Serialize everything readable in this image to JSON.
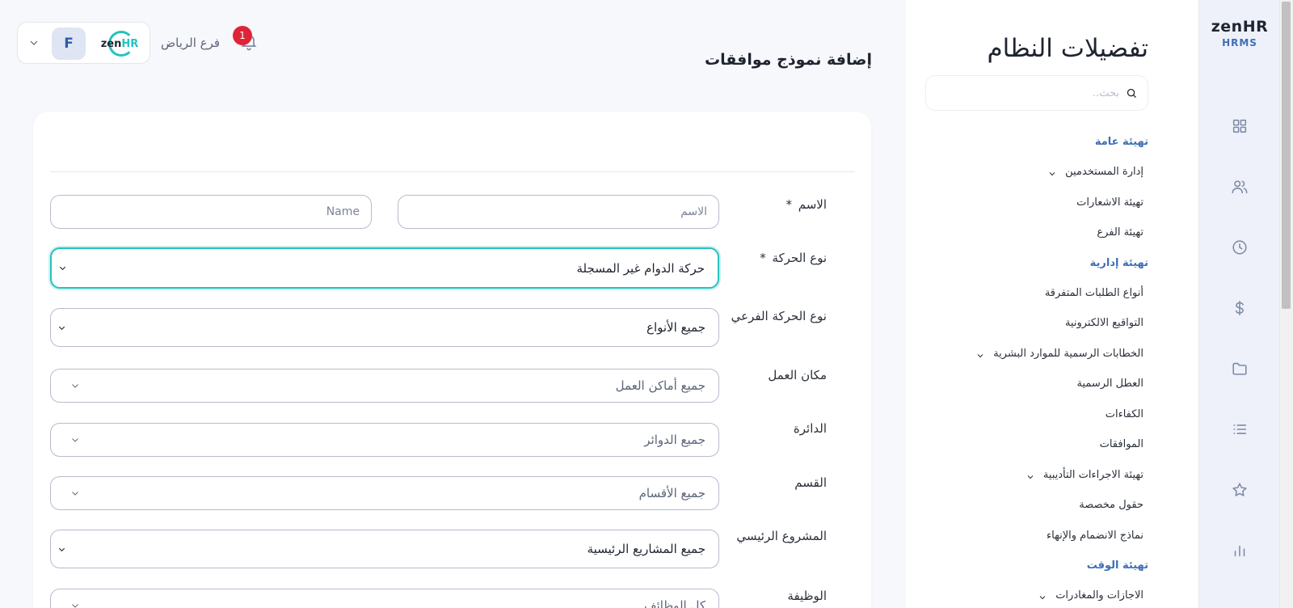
{
  "brand": {
    "word_main": "zen",
    "word_accent": "HR",
    "sub": "HRMS"
  },
  "rail_icons": [
    "dashboard-icon",
    "users-icon",
    "clock-icon",
    "dollar-icon",
    "folder-icon",
    "list-icon",
    "star-icon",
    "chart-icon"
  ],
  "settings": {
    "title": "تفضيلات النظام",
    "search_placeholder": "بحث..",
    "menu": [
      {
        "type": "group",
        "label": "تهيئة عامة"
      },
      {
        "type": "item",
        "label": "إدارة المستخدمين",
        "expandable": true
      },
      {
        "type": "item",
        "label": "تهيئة الاشعارات"
      },
      {
        "type": "item",
        "label": "تهيئة الفرع"
      },
      {
        "type": "group",
        "label": "تهيئة إدارية"
      },
      {
        "type": "item",
        "label": "أنواع الطلبات المتفرقة"
      },
      {
        "type": "item",
        "label": "التواقيع الالكترونية"
      },
      {
        "type": "item",
        "label": "الخطابات الرسمية للموارد البشرية",
        "expandable": true
      },
      {
        "type": "item",
        "label": "العطل الرسمية"
      },
      {
        "type": "item",
        "label": "الكفاءات"
      },
      {
        "type": "item",
        "label": "الموافقات"
      },
      {
        "type": "item",
        "label": "تهيئة الاجراءات التأديبية",
        "expandable": true
      },
      {
        "type": "item",
        "label": "حقول مخصصة"
      },
      {
        "type": "item",
        "label": "نماذج الانضمام والإنهاء"
      },
      {
        "type": "group",
        "label": "تهيئة الوقت"
      },
      {
        "type": "item",
        "label": "الاجازات والمغادرات",
        "expandable": true
      }
    ]
  },
  "header": {
    "branch": "فرع الرياض",
    "notification_count": "1",
    "avatar_initial": "F",
    "widget_logo_main": "zen",
    "widget_logo_accent": "HR"
  },
  "page_title": "إضافة نموذج موافقات",
  "form": {
    "name": {
      "label": "الاسم",
      "required": "*",
      "ar_placeholder": "الاسم",
      "en_placeholder": "Name"
    },
    "movement_type": {
      "label": "نوع الحركة",
      "required": "*",
      "value": "حركة الدوام غير المسجلة"
    },
    "sub_movement_type": {
      "label": "نوع الحركة الفرعي",
      "value": "جميع الأنواع"
    },
    "work_location": {
      "label": "مكان العمل",
      "value": "جميع أماكن العمل"
    },
    "department": {
      "label": "الدائرة",
      "value": "جميع الدوائر"
    },
    "section": {
      "label": "القسم",
      "value": "جميع الأقسام"
    },
    "main_project": {
      "label": "المشروع الرئيسي",
      "value": "جميع المشاريع الرئيسية"
    },
    "job": {
      "label": "الوظيفة",
      "value": "كل الوظائف"
    }
  }
}
